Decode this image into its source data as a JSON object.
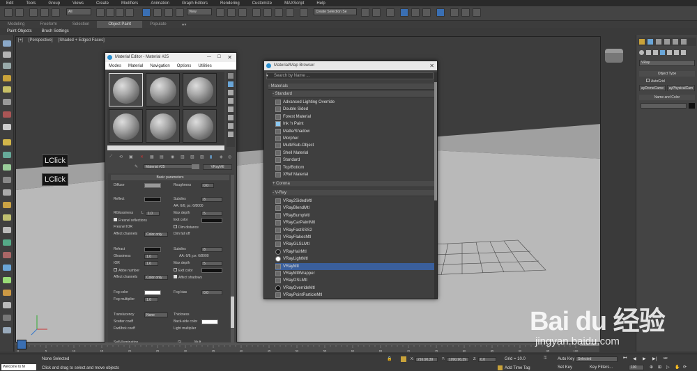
{
  "menubar": [
    "Edit",
    "Tools",
    "Group",
    "Views",
    "Create",
    "Modifiers",
    "Animation",
    "Graph Editors",
    "Rendering",
    "Customize",
    "MAXScript",
    "Help"
  ],
  "toolbar": {
    "selection_filter": "All",
    "view": "View",
    "named_selection": "Create Selection Se"
  },
  "ribbon": {
    "tabs": [
      "Modeling",
      "Freeform",
      "Selection",
      "Object Paint",
      "Populate"
    ],
    "active": "Object Paint",
    "sub": [
      "Paint Objects",
      "Brush Settings"
    ]
  },
  "viewport": {
    "label1": "[+]",
    "label2": "[Perspective]",
    "label3": "[Shaded + Edged Faces]"
  },
  "lclick": [
    "LClick",
    "LClick"
  ],
  "material_editor": {
    "title": "Material Editor - Material #25",
    "menu": [
      "Modes",
      "Material",
      "Navigation",
      "Options",
      "Utilities"
    ],
    "material_name": "Material #25",
    "material_type": "VRayMtl",
    "rollout": "Basic parameters",
    "diffuse": "Diffuse",
    "roughness": "Roughness",
    "roughness_val": "0.0",
    "reflect": "Reflect",
    "subdivs": "Subdivs",
    "subdivs_val": "8",
    "rglossiness": "RGlossiness",
    "l": "L",
    "rgloss_val": "1.0",
    "max_depth": "Max depth",
    "max_depth_val": "5",
    "aa": "AA: 6/6; px: 6/8000",
    "fresnel": "Fresnel reflections",
    "exit_color": "Exit color",
    "fresnel_ior": "Fresnel IOR",
    "dim_distance": "Dim distance",
    "affect_channels": "Affect channels",
    "color_only": "Color only",
    "dim_falloff": "Dim fall off",
    "refract": "Refract",
    "rsubdivs": "Subdivs",
    "rsubdivs_val": "8",
    "glossiness": "Glossiness",
    "gloss_val": "1.0",
    "raa": "AA: 6/6; px: 6/8000",
    "ior": "IOR",
    "ior_val": "1.6",
    "rmax_depth": "Max depth",
    "rmax_depth_val": "5",
    "abbe": "Abbe number",
    "rexit": "Exit color",
    "raffect": "Affect channels",
    "rcolor_only": "Color only",
    "affect_shadows": "Affect shadows",
    "fog_color": "Fog color",
    "fog_bias": "Fog bias",
    "fog_bias_val": "0.0",
    "fog_mult": "Fog multiplier",
    "fog_mult_val": "1.0",
    "translucency": "Translucency",
    "none": "None",
    "thickness": "Thickness",
    "scatter": "Scatter coeff",
    "back_side": "Back-side color",
    "fwd_bck": "Fwd/bck coeff",
    "light_mult": "Light multiplier",
    "self_illum": "Self-illumination",
    "gi": "GI",
    "mult": "Mult"
  },
  "material_browser": {
    "title": "Material/Map Browser",
    "search_placeholder": "Search by Name ...",
    "materials": "- Materials",
    "standard": "- Standard",
    "standard_items": [
      "Advanced Lighting Override",
      "Double Sided",
      "Forest Material",
      "Ink 'n Paint",
      "Matte/Shadow",
      "Morpher",
      "Multi/Sub-Object",
      "Shell Material",
      "Standard",
      "Top/Bottom",
      "XRef Material"
    ],
    "corona": "+ Corona",
    "vray": "- V-Ray",
    "vray_items": [
      "VRay2SidedMtl",
      "VRayBlendMtl",
      "VRayBumpMtl",
      "VRayCarPaintMtl",
      "VRayFastSSS2",
      "VRayFlakesMtl",
      "VRayGLSLMtl",
      "VRayHairMtl",
      "VRayLightMtl",
      "VRayMtl",
      "VRayMtlWrapper",
      "VRayOSLMtl",
      "VRayOverrideMtl",
      "VRayPointParticleMtl"
    ],
    "selected": "VRayMtl"
  },
  "cmdpanel": {
    "dropdown": "VRay",
    "object_type": "Object Type",
    "autogrid": "AutoGrid",
    "btn1": "ayDomeCame",
    "btn2": "ayPhysicalCam",
    "name_color": "Name and Color"
  },
  "timeline": {
    "counter": "100 / 100",
    "ticks": [
      "0",
      "5",
      "10",
      "15",
      "20",
      "25",
      "30",
      "35",
      "40",
      "45",
      "50",
      "55",
      "60",
      "65",
      "70",
      "75",
      "80",
      "85",
      "90",
      "95",
      "100"
    ]
  },
  "status": {
    "script": "Welcome to M",
    "selected": "None Selected",
    "hint": "Click and drag to select and move objects",
    "x": "X:",
    "xval": "216.90,39",
    "y": "Y:",
    "yval": "1090.96,39",
    "z": "Z:",
    "zval": "0.0",
    "grid": "Grid = 10.0",
    "add_time_tag": "Add Time Tag",
    "auto_key": "Auto Key",
    "selected_dd": "Selected",
    "set_key": "Set Key",
    "key_filters": "Key Filters...",
    "frame": "100"
  },
  "watermark": {
    "brand": "Bai du 经验",
    "url": "jingyan.baidu.com"
  }
}
